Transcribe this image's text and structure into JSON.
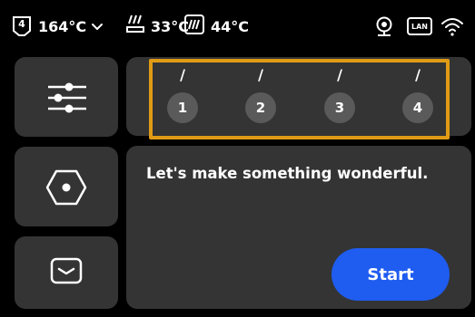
{
  "status": {
    "nozzle_slot": "4",
    "nozzle_temp": "164°C",
    "bed_temp": "33°C",
    "chamber_temp": "44°C",
    "network_label": "LAN"
  },
  "filament": {
    "slots": [
      {
        "mark": "/",
        "number": "1"
      },
      {
        "mark": "/",
        "number": "2"
      },
      {
        "mark": "/",
        "number": "3"
      },
      {
        "mark": "/",
        "number": "4"
      }
    ]
  },
  "main": {
    "message": "Let's make something wonderful.",
    "start_label": "Start"
  },
  "colors": {
    "background": "#000000",
    "panel": "#343434",
    "accent": "#1f5cf0",
    "highlight": "#e09b15",
    "slot_fill": "#5a5a5a"
  },
  "icons": {
    "menu": [
      "sliders-icon",
      "nozzle-hex-icon",
      "tray-icon"
    ],
    "status": [
      "nozzle-icon",
      "chevron-down-icon",
      "heatbed-icon",
      "chamber-icon",
      "camera-icon",
      "lan-icon",
      "wifi-icon"
    ]
  }
}
